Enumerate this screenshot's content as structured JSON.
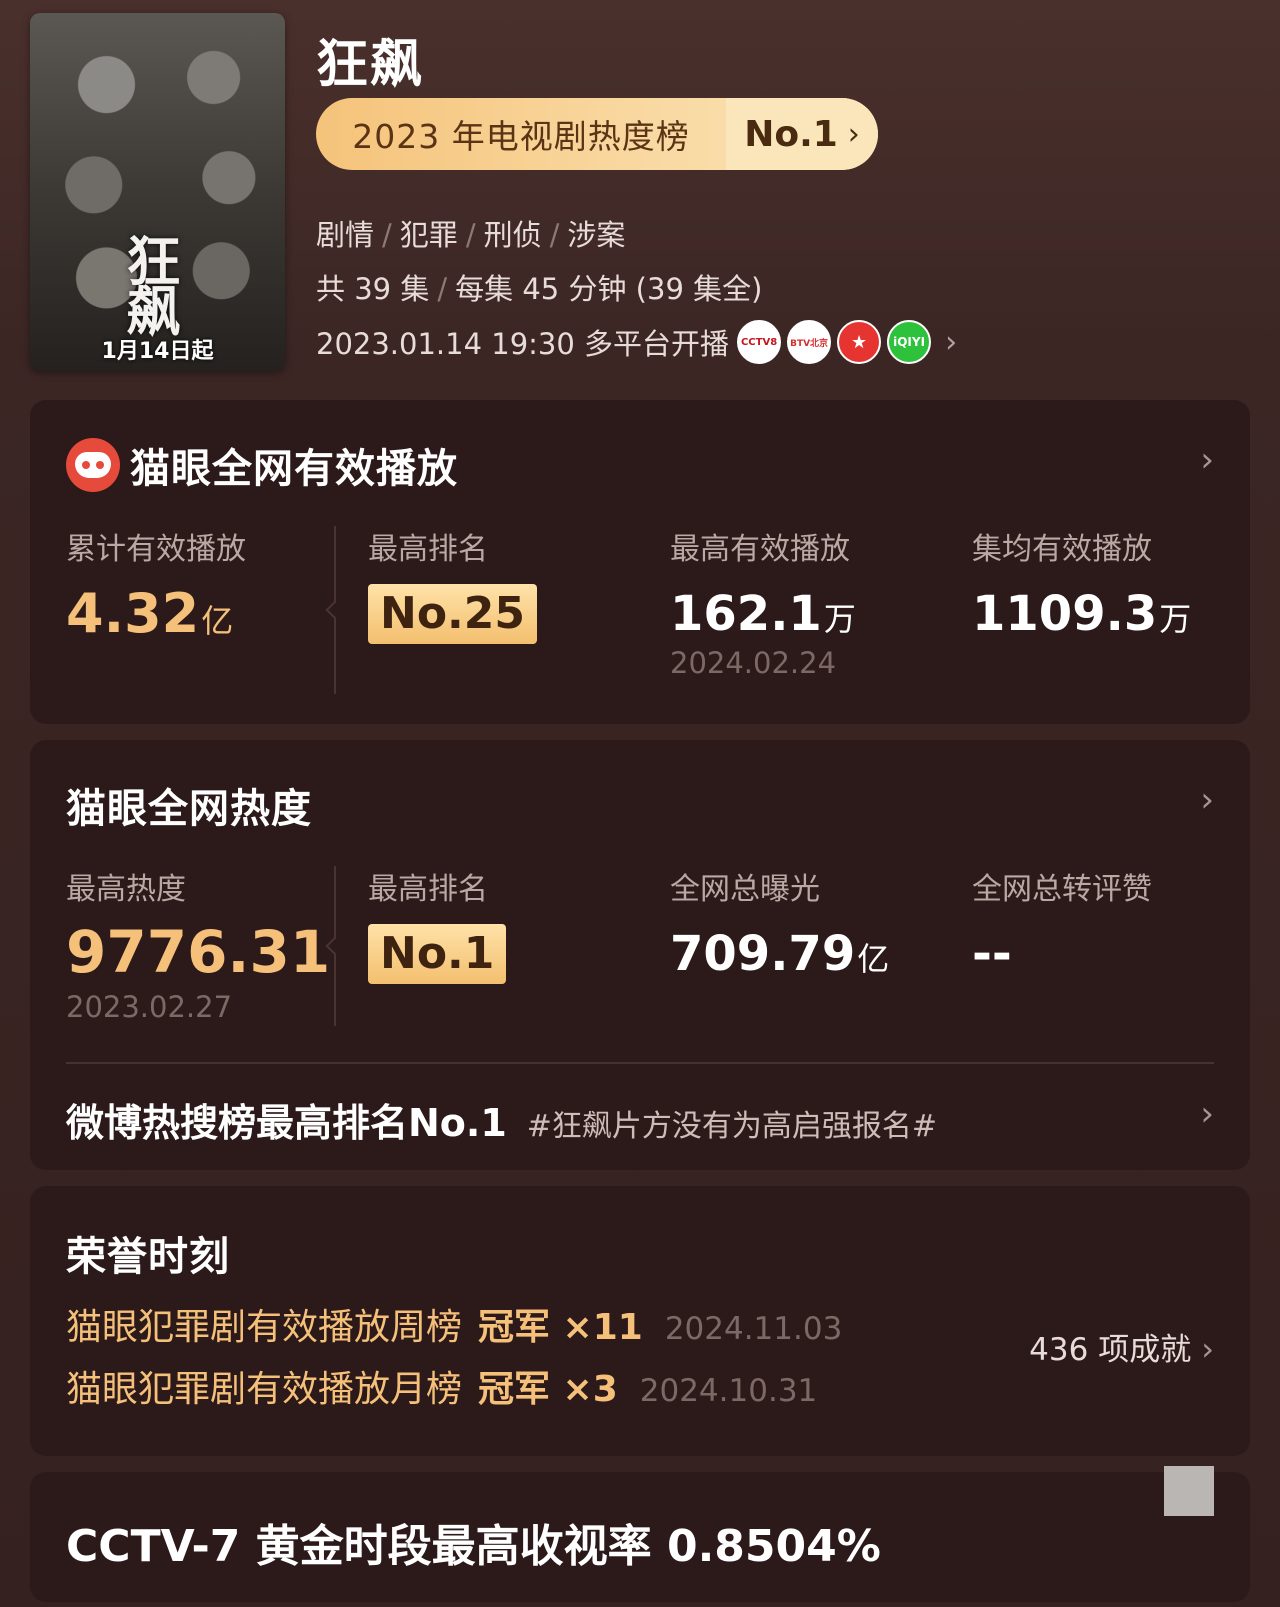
{
  "show": {
    "title": "狂飙",
    "poster_title": "狂飙",
    "poster_date": "1月14日起",
    "rank_label": "2023 年电视剧热度榜",
    "rank_value": "No.1",
    "genres": [
      "剧情",
      "犯罪",
      "刑侦",
      "涉案"
    ],
    "episodes": "共 39 集",
    "episode_length": "每集 45 分钟 (39 集全)",
    "premiere": "2023.01.14 19:30 多平台开播",
    "platforms": [
      {
        "name": "CCTV8",
        "icon": "cctv8-logo-icon"
      },
      {
        "name": "BTV 北京",
        "icon": "btv-logo-icon"
      },
      {
        "name": "东方卫视",
        "icon": "dragon-tv-logo-icon"
      },
      {
        "name": "iQIYI",
        "icon": "iqiyi-logo-icon"
      }
    ]
  },
  "playback": {
    "title": "猫眼全网有效播放",
    "cumulative_label": "累计有效播放",
    "cumulative_value": "4.32",
    "cumulative_unit": "亿",
    "top_rank_label": "最高排名",
    "top_rank_value": "No.25",
    "peak_label": "最高有效播放",
    "peak_value": "162.1",
    "peak_unit": "万",
    "peak_date": "2024.02.24",
    "avg_label": "集均有效播放",
    "avg_value": "1109.3",
    "avg_unit": "万"
  },
  "heat": {
    "title": "猫眼全网热度",
    "peak_label": "最高热度",
    "peak_value": "9776.31",
    "peak_date": "2023.02.27",
    "top_rank_label": "最高排名",
    "top_rank_value": "No.1",
    "exposure_label": "全网总曝光",
    "exposure_value": "709.79",
    "exposure_unit": "亿",
    "engagement_label": "全网总转评赞",
    "engagement_value": "--",
    "weibo_main": "微博热搜榜最高排名No.1",
    "weibo_tag": "#狂飙片方没有为高启强报名#"
  },
  "honors": {
    "title": "荣誉时刻",
    "items": [
      {
        "title": "猫眼犯罪剧有效播放周榜",
        "champ": "冠军 ×11",
        "date": "2024.11.03"
      },
      {
        "title": "猫眼犯罪剧有效播放月榜",
        "champ": "冠军 ×3",
        "date": "2024.10.31"
      }
    ],
    "achievements": "436 项成就"
  },
  "rating": {
    "text": "CCTV-7 黄金时段最高收视率 0.8504%"
  },
  "colors": {
    "background": "#3a2624",
    "card": "#2c1919",
    "gold": "#f4c07a",
    "badge_gold": "#f3bf6f"
  }
}
